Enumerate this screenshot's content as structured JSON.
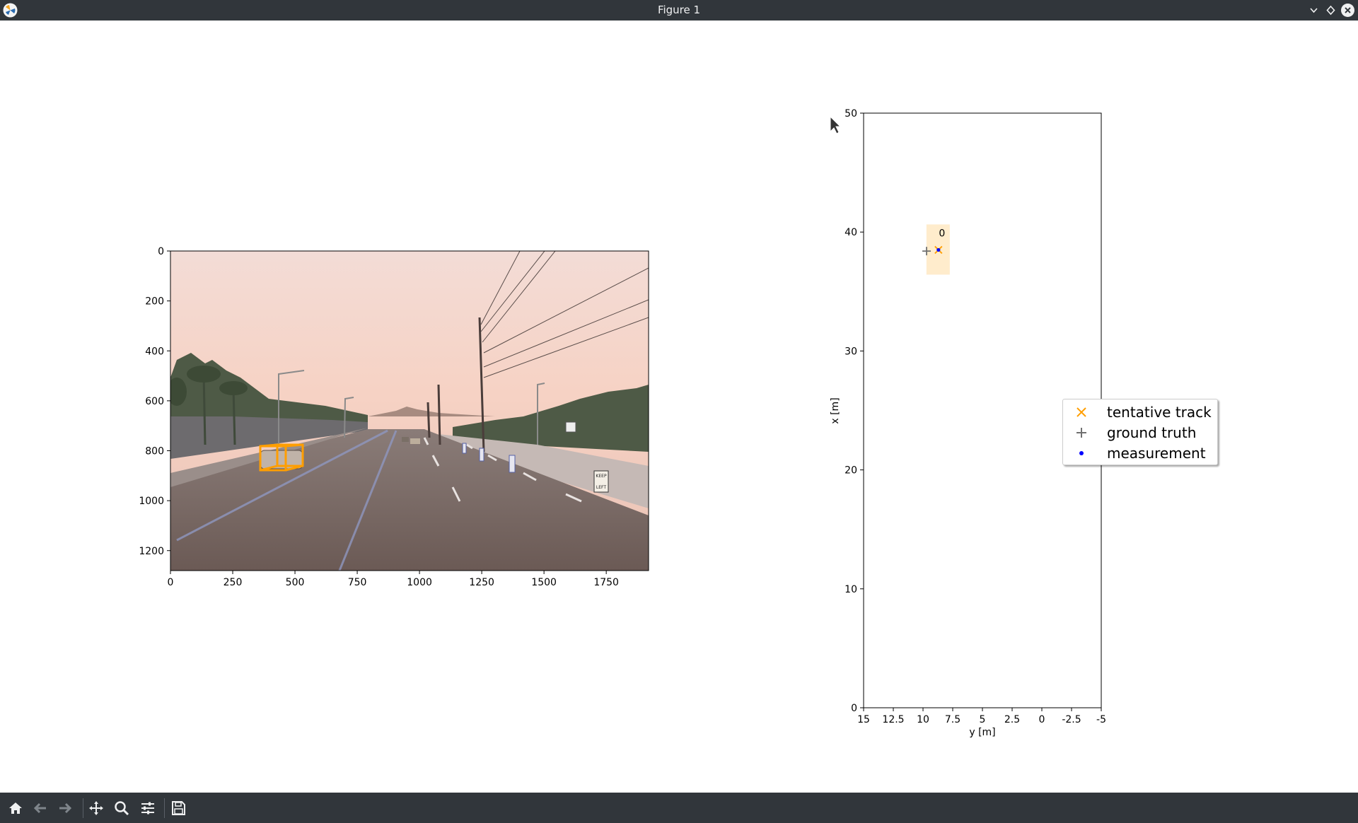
{
  "window": {
    "title": "Figure 1"
  },
  "camera_plot": {
    "x_ticks": [
      "0",
      "250",
      "500",
      "750",
      "1000",
      "1250",
      "1500",
      "1750"
    ],
    "y_ticks": [
      "0",
      "200",
      "400",
      "600",
      "800",
      "1000",
      "1200"
    ],
    "box_color": "#ff9e00",
    "road_signs": [
      "KEEP",
      "LEFT"
    ]
  },
  "bev_plot": {
    "xlabel": "y [m]",
    "ylabel": "x [m]",
    "x_ticks": [
      "15",
      "12.5",
      "10",
      "7.5",
      "5",
      "2.5",
      "0",
      "-2.5",
      "-5"
    ],
    "y_ticks": [
      "0",
      "10",
      "20",
      "30",
      "40",
      "50"
    ],
    "track_id": "0",
    "track_color": "#ff9e00",
    "ground_truth_color": "#707070",
    "measurement_color": "#0000ff"
  },
  "chart_data": {
    "type": "scatter",
    "xlabel": "y [m]",
    "ylabel": "x [m]",
    "xlim": [
      15,
      -5
    ],
    "ylim": [
      0,
      50
    ],
    "series": [
      {
        "name": "tentative track",
        "points": [
          {
            "y": 8.7,
            "x": 38.5
          }
        ]
      },
      {
        "name": "ground truth",
        "points": [
          {
            "y": 9.7,
            "x": 38.4
          }
        ]
      },
      {
        "name": "measurement",
        "points": [
          {
            "y": 8.7,
            "x": 38.5
          }
        ]
      }
    ],
    "annotations": [
      "0"
    ],
    "legend": "center-right"
  },
  "legend": {
    "items": [
      {
        "label": "tentative track",
        "icon": "x-marker-icon"
      },
      {
        "label": "ground truth",
        "icon": "plus-marker-icon"
      },
      {
        "label": "measurement",
        "icon": "dot-marker-icon"
      }
    ]
  },
  "toolbar": {
    "buttons": [
      "home-icon",
      "back-arrow-icon",
      "forward-arrow-icon",
      "pan-icon",
      "zoom-icon",
      "configure-subplots-icon",
      "save-icon"
    ]
  }
}
